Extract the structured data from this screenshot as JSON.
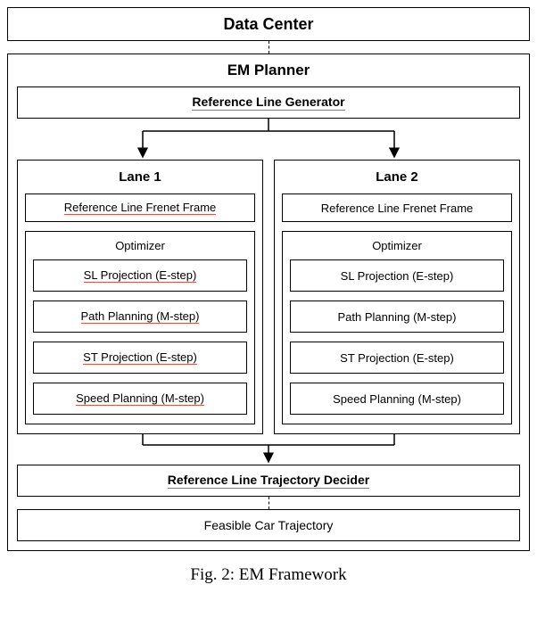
{
  "data_center": "Data Center",
  "em_planner": {
    "title": "EM Planner",
    "ref_line_gen": "Reference Line Generator",
    "lanes": [
      {
        "title": "Lane 1",
        "frenet": "Reference Line Frenet Frame",
        "optimizer_title": "Optimizer",
        "steps": [
          "SL Projection (E-step)",
          "Path Planning (M-step)",
          "ST Projection (E-step)",
          "Speed Planning (M-step)"
        ],
        "underline": true
      },
      {
        "title": "Lane 2",
        "frenet": "Reference Line Frenet Frame",
        "optimizer_title": "Optimizer",
        "steps": [
          "SL Projection (E-step)",
          "Path Planning (M-step)",
          "ST Projection (E-step)",
          "Speed Planning (M-step)"
        ],
        "underline": false
      }
    ],
    "decider": "Reference Line Trajectory Decider",
    "feasible": "Feasible Car Trajectory"
  },
  "caption": "Fig. 2: EM Framework",
  "chart_data": {
    "type": "diagram",
    "title": "EM Framework",
    "root": {
      "node": "Data Center",
      "child_style": "dashed",
      "children": [
        {
          "node": "EM Planner",
          "children": [
            {
              "node": "Reference Line Generator",
              "child_style": "solid-arrow-split",
              "children": [
                {
                  "node": "Lane 1",
                  "children": [
                    {
                      "node": "Reference Line Frenet Frame"
                    },
                    {
                      "node": "Optimizer",
                      "children": [
                        {
                          "node": "SL Projection (E-step)"
                        },
                        {
                          "node": "Path Planning (M-step)"
                        },
                        {
                          "node": "ST Projection (E-step)"
                        },
                        {
                          "node": "Speed Planning (M-step)"
                        }
                      ]
                    }
                  ]
                },
                {
                  "node": "Lane 2",
                  "children": [
                    {
                      "node": "Reference Line Frenet Frame"
                    },
                    {
                      "node": "Optimizer",
                      "children": [
                        {
                          "node": "SL Projection (E-step)"
                        },
                        {
                          "node": "Path Planning (M-step)"
                        },
                        {
                          "node": "ST Projection (E-step)"
                        },
                        {
                          "node": "Speed Planning (M-step)"
                        }
                      ]
                    }
                  ]
                }
              ],
              "merge_to": "Reference Line Trajectory Decider"
            },
            {
              "node": "Reference Line Trajectory Decider",
              "child_style": "dashed",
              "children": [
                {
                  "node": "Feasible Car Trajectory"
                }
              ]
            }
          ]
        }
      ]
    }
  }
}
